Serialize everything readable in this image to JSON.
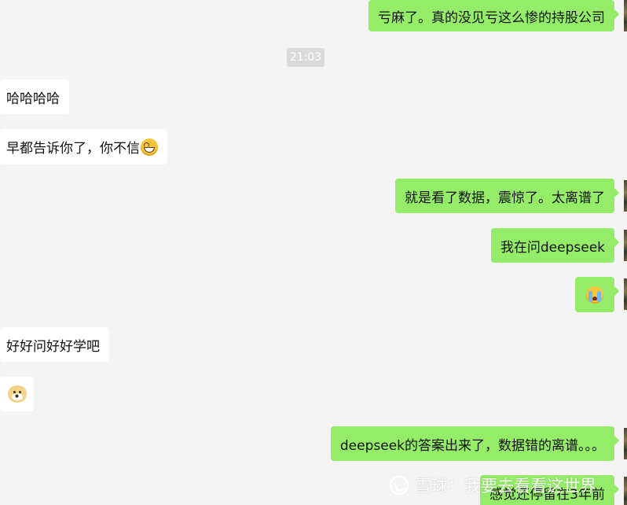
{
  "conversation": {
    "timestamp": "21:03",
    "messages": [
      {
        "side": "right",
        "text": "亏麻了。真的没见亏这么惨的持股公司"
      },
      {
        "side": "left",
        "text": "哈哈哈哈"
      },
      {
        "side": "left",
        "text": "早都告诉你了，你不信",
        "emoji": "grin-emoji"
      },
      {
        "side": "right",
        "text": "就是看了数据，震惊了。太离谱了"
      },
      {
        "side": "right",
        "text": "我在问deepseek"
      },
      {
        "side": "right",
        "emoji": "crying-emoji"
      },
      {
        "side": "left",
        "text": "好好问好好学吧"
      },
      {
        "side": "left",
        "emoji": "doge-emoji"
      },
      {
        "side": "right",
        "text": "deepseek的答案出来了，数据错的离谱。。。"
      },
      {
        "side": "right",
        "text": "感觉还停留在3年前"
      }
    ]
  },
  "watermark": {
    "text": "雪球：我要去看看这世界",
    "icon": "snowball-logo-icon"
  },
  "colors": {
    "background": "#f4f4f4",
    "outgoing_bubble": "#95ec69",
    "incoming_bubble": "#ffffff",
    "timestamp_bg": "#dadada"
  }
}
